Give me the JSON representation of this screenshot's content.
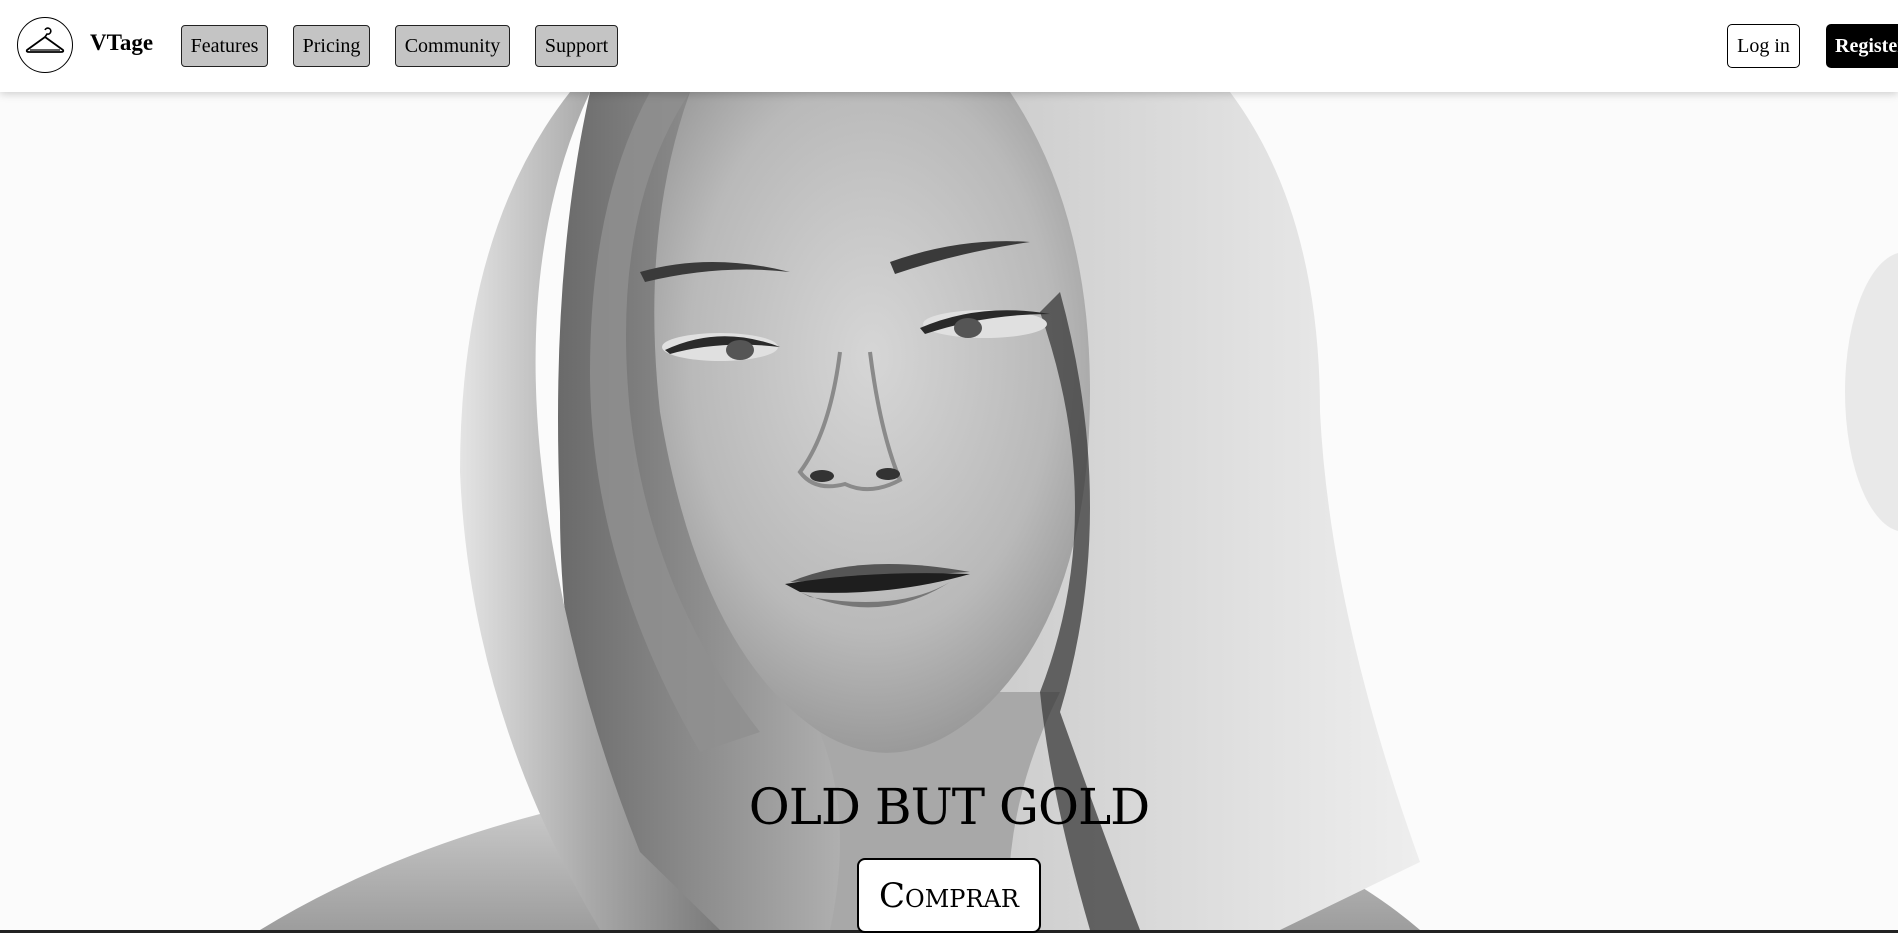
{
  "brand": {
    "name": "VTage",
    "logo_icon": "hanger-icon"
  },
  "nav": {
    "items": [
      {
        "label": "Features"
      },
      {
        "label": "Pricing"
      },
      {
        "label": "Community"
      },
      {
        "label": "Support"
      }
    ]
  },
  "auth": {
    "login_label": "Log in",
    "register_label": "Register"
  },
  "hero": {
    "title": "OLD BUT GOLD",
    "cta_label": "Comprar"
  },
  "colors": {
    "nav_button_bg": "#c4c4c4",
    "register_bg": "#000000",
    "background": "#ffffff"
  }
}
